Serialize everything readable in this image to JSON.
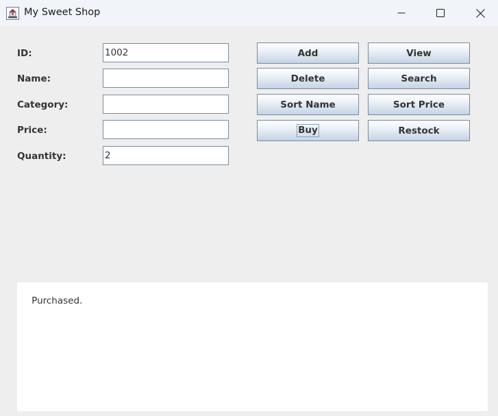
{
  "window": {
    "title": "My Sweet Shop"
  },
  "form": {
    "id_label": "ID:",
    "id_value": "1002",
    "name_label": "Name:",
    "name_value": "",
    "category_label": "Category:",
    "category_value": "",
    "price_label": "Price:",
    "price_value": "",
    "quantity_label": "Quantity:",
    "quantity_value": "2"
  },
  "buttons": {
    "add": "Add",
    "view": "View",
    "delete": "Delete",
    "search": "Search",
    "sort_name": "Sort Name",
    "sort_price": "Sort Price",
    "buy": "Buy",
    "restock": "Restock"
  },
  "output": {
    "text": "Purchased."
  },
  "icons": {
    "app": "java-coffee-cup-icon",
    "minimize": "minimize-icon",
    "maximize": "maximize-icon",
    "close": "close-icon"
  },
  "colors": {
    "background": "#eeeeee",
    "titlebar": "#f1f4f9",
    "button_border": "#7a8a9a",
    "field_border": "#7a8a99"
  }
}
